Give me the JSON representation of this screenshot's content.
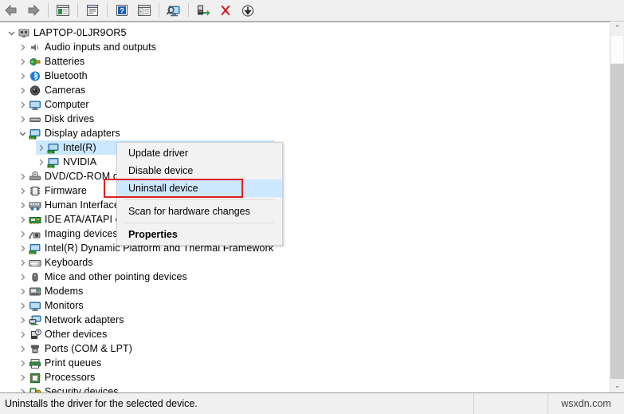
{
  "window": {
    "status_text": "Uninstalls the driver for the selected device.",
    "watermark": "wsxdn.com"
  },
  "toolbar": {
    "buttons": [
      {
        "name": "back-button",
        "icon": "arrow-left-icon",
        "label": "Back"
      },
      {
        "name": "forward-button",
        "icon": "arrow-right-icon",
        "label": "Forward"
      },
      {
        "name": "show-hide-console-tree-button",
        "icon": "console-tree-icon",
        "label": "Show/Hide Console Tree"
      },
      {
        "name": "properties-button",
        "icon": "properties-window-icon",
        "label": "Properties"
      },
      {
        "name": "help-button",
        "icon": "help-question-icon",
        "label": "Help"
      },
      {
        "name": "view-button",
        "icon": "view-list-icon",
        "label": "View"
      },
      {
        "name": "scan-hardware-changes-button",
        "icon": "scan-monitor-icon",
        "label": "Scan for hardware changes"
      },
      {
        "name": "update-driver-button",
        "icon": "update-driver-icon",
        "label": "Update driver"
      },
      {
        "name": "uninstall-device-button",
        "icon": "red-x-icon",
        "label": "Uninstall device"
      },
      {
        "name": "disable-device-button",
        "icon": "disable-down-arrow-icon",
        "label": "Disable device"
      }
    ]
  },
  "tree": {
    "root": {
      "label": "LAPTOP-0LJR9OR5",
      "icon": "computer-node-icon",
      "expanded": true
    },
    "items": [
      {
        "label": "Audio inputs and outputs",
        "icon": "speaker-icon",
        "indent": 1,
        "expanded": false
      },
      {
        "label": "Batteries",
        "icon": "battery-icon",
        "indent": 1,
        "expanded": false
      },
      {
        "label": "Bluetooth",
        "icon": "bluetooth-icon",
        "indent": 1,
        "expanded": false
      },
      {
        "label": "Cameras",
        "icon": "camera-icon",
        "indent": 1,
        "expanded": false
      },
      {
        "label": "Computer",
        "icon": "monitor-icon",
        "indent": 1,
        "expanded": false
      },
      {
        "label": "Disk drives",
        "icon": "disk-drive-icon",
        "indent": 1,
        "expanded": false
      },
      {
        "label": "Display adapters",
        "icon": "display-adapter-icon",
        "indent": 1,
        "expanded": true
      },
      {
        "label": "Intel(R)",
        "icon": "display-adapter-icon",
        "indent": 2,
        "selected": true
      },
      {
        "label": "NVIDIA",
        "icon": "display-adapter-icon",
        "indent": 2,
        "selected": false
      },
      {
        "label": "DVD/CD-ROM drives",
        "icon": "dvd-drive-icon",
        "indent": 1,
        "expanded": false
      },
      {
        "label": "Firmware",
        "icon": "firmware-chip-icon",
        "indent": 1,
        "expanded": false
      },
      {
        "label": "Human Interface Devices",
        "icon": "hid-icon",
        "indent": 1,
        "expanded": false
      },
      {
        "label": "IDE ATA/ATAPI controllers",
        "icon": "ide-controller-icon",
        "indent": 1,
        "expanded": false
      },
      {
        "label": "Imaging devices",
        "icon": "imaging-device-icon",
        "indent": 1,
        "expanded": false
      },
      {
        "label": "Intel(R) Dynamic Platform and Thermal Framework",
        "icon": "display-adapter-icon",
        "indent": 1,
        "expanded": false
      },
      {
        "label": "Keyboards",
        "icon": "keyboard-icon",
        "indent": 1,
        "expanded": false
      },
      {
        "label": "Mice and other pointing devices",
        "icon": "mouse-icon",
        "indent": 1,
        "expanded": false
      },
      {
        "label": "Modems",
        "icon": "modem-icon",
        "indent": 1,
        "expanded": false
      },
      {
        "label": "Monitors",
        "icon": "monitor-icon",
        "indent": 1,
        "expanded": false
      },
      {
        "label": "Network adapters",
        "icon": "network-adapter-icon",
        "indent": 1,
        "expanded": false
      },
      {
        "label": "Other devices",
        "icon": "other-device-icon",
        "indent": 1,
        "expanded": false
      },
      {
        "label": "Ports (COM & LPT)",
        "icon": "port-icon",
        "indent": 1,
        "expanded": false
      },
      {
        "label": "Print queues",
        "icon": "printer-icon",
        "indent": 1,
        "expanded": false
      },
      {
        "label": "Processors",
        "icon": "processor-icon",
        "indent": 1,
        "expanded": false
      },
      {
        "label": "Security devices",
        "icon": "security-device-icon",
        "indent": 1,
        "expanded": false
      }
    ]
  },
  "context_menu": {
    "items": [
      {
        "label": "Update driver",
        "type": "item",
        "highlighted": false,
        "bold": false
      },
      {
        "label": "Disable device",
        "type": "item",
        "highlighted": false,
        "bold": false
      },
      {
        "label": "Uninstall device",
        "type": "item",
        "highlighted": true,
        "bold": false
      },
      {
        "type": "separator"
      },
      {
        "label": "Scan for hardware changes",
        "type": "item",
        "highlighted": false,
        "bold": false
      },
      {
        "type": "separator"
      },
      {
        "label": "Properties",
        "type": "item",
        "highlighted": false,
        "bold": true
      }
    ]
  },
  "colors": {
    "selection": "#cce8ff",
    "highlight_box": "#e02020",
    "chrome": "#f0f0f0",
    "text": "#000000"
  },
  "scrollbar": {
    "up_arrow": "⌃",
    "down_arrow": "⌄"
  }
}
